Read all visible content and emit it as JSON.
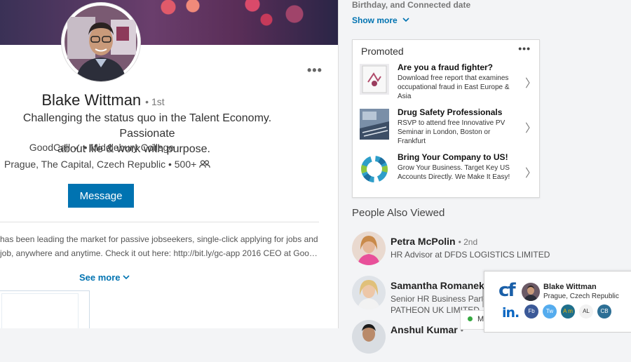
{
  "profile": {
    "name": "Blake Wittman",
    "degree": "• 1st",
    "headline_line1": "Challenging the status quo in the Talent Economy. Passionate",
    "headline_line2": "about life & work with purpose.",
    "company": "GoodCall ✓ • Middlebury College",
    "location": "Prague, The Capital, Czech Republic",
    "connections": "• 500+",
    "message_label": "Message",
    "more_glyph": "•••",
    "summary_line1": "has been leading the market for passive jobseekers, single-click applying for jobs and",
    "summary_line2": "job, anywhere and anytime. Check it out here: http://bit.ly/gc-app 2016 CEO at Goo…",
    "see_more_label": "See more"
  },
  "sidebar": {
    "birthday_text": "Birthday, and Connected date",
    "show_more_label": "Show more",
    "promoted": {
      "title": "Promoted",
      "menu_glyph": "•••",
      "ads": [
        {
          "headline": "Are you a fraud fighter?",
          "body": "Download free report that examines occupational fraud in East Europe & Asia"
        },
        {
          "headline": "Drug Safety Professionals",
          "body": "RSVP to attend free Innovative PV Seminar in London, Boston or Frankfurt"
        },
        {
          "headline": "Bring Your Company to US!",
          "body": "Grow Your Business. Target Key US Accounts Directly. We Make It Easy!"
        }
      ]
    },
    "people_also_viewed": {
      "title": "People Also Viewed",
      "people": [
        {
          "name": "Petra McPolin",
          "degree": "• 2nd",
          "title": "HR Advisor at DFDS LOGISTICS LIMITED",
          "title2": ""
        },
        {
          "name": "Samantha Romanek",
          "degree": "•",
          "title": "Senior HR Business Partr",
          "title2": "PATHEON UK LIMITED"
        },
        {
          "name": "Anshul Kumar",
          "degree": "•",
          "title": "",
          "title2": ""
        }
      ]
    }
  },
  "messaging": {
    "label": "M"
  },
  "widget": {
    "logo": "cf",
    "name": "Blake Wittman",
    "location": "Prague, Czech Republic",
    "linkedin": "in.",
    "badges": [
      {
        "label": "Fb",
        "color": "#3b5998"
      },
      {
        "label": "Tw",
        "color": "#55acee"
      },
      {
        "label": "A m",
        "color": "#1f6f8b"
      },
      {
        "label": "AL",
        "color": "#f2f2f2"
      },
      {
        "label": "CB",
        "color": "#2d6f95"
      }
    ]
  }
}
